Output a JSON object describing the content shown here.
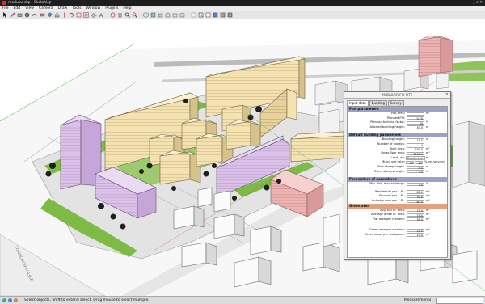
{
  "window": {
    "title": "modular.skp - SketchUp"
  },
  "menu": [
    "File",
    "Edit",
    "View",
    "Camera",
    "Draw",
    "Tools",
    "Window",
    "Plugins",
    "Help"
  ],
  "toolbar_icons": [
    "select-icon",
    "pencil-icon",
    "rectangle-icon",
    "circle-icon",
    "arc-icon",
    "eraser-icon",
    "paint-icon",
    "push-pull-icon",
    "move-icon",
    "rotate-icon",
    "scale-icon",
    "offset-icon",
    "tape-icon",
    "text-icon",
    "orbit-icon",
    "pan-icon",
    "zoom-icon",
    "zoom-extents-icon",
    "iso-view-icon",
    "top-view-icon",
    "front-view-icon",
    "right-view-icon",
    "back-view-icon",
    "left-view-icon",
    "xray-icon",
    "wireframe-icon",
    "hidden-line-icon",
    "shaded-icon",
    "textured-icon",
    "monochrome-icon"
  ],
  "street_label": "TONOLIKOVA ULICE",
  "panel": {
    "title": "MODULAR FIX SITE",
    "tabs": [
      "Input data",
      "Building",
      "Survey"
    ],
    "plot": {
      "header": "Plot parameters",
      "rows": [
        {
          "label": "Plot area:",
          "value": "",
          "unit": "m²"
        },
        {
          "label": "Planned FSI:",
          "value": "0.70",
          "unit": ""
        },
        {
          "label": "Planned building factor:",
          "value": "35",
          "unit": "%"
        },
        {
          "label": "Allowed building height:",
          "value": "40.0",
          "unit": "m"
        }
      ]
    },
    "default_building": {
      "header": "Default building parameters",
      "rows": [
        {
          "label": "Building height:",
          "value": "15.0",
          "unit": "m"
        },
        {
          "label": "Number of storeys:",
          "value": "4",
          "unit": ""
        },
        {
          "label": "Built area:",
          "value": "250.0",
          "unit": "m²"
        },
        {
          "label": "Gross floor area:",
          "value": "1000.0",
          "unit": "m²"
        },
        {
          "label": "Land use:",
          "value": "Residential",
          "unit": ""
        }
      ],
      "mixed_use": {
        "label": "Mixed use ratio:",
        "v1": "80",
        "v2": "20",
        "unit": "%",
        "note": "res.serv.ind"
      },
      "rows2": [
        {
          "label": "First storey height:",
          "value": "4.0",
          "unit": "m"
        },
        {
          "label": "Other storeys height:",
          "value": "3.5",
          "unit": "m"
        }
      ]
    },
    "norms": {
      "header": "Parameters of normatives",
      "rows": [
        {
          "label": "Min. dist. btw. buildings:",
          "value": "1.0",
          "unit": "%"
        },
        {
          "label": "Residential per 1 PL:",
          "value": "80.0",
          "unit": "m²"
        },
        {
          "label": "Services per 1 PL:",
          "value": "30.0",
          "unit": "m²"
        },
        {
          "label": "Industry area per 1 PL:",
          "value": "80.0",
          "unit": "m²"
        }
      ]
    },
    "green": {
      "header": "Green area",
      "rows": [
        {
          "label": "Avg. flat gr. area:",
          "value": "75.0",
          "unit": "m²"
        },
        {
          "label": "Average office gr. area:",
          "value": "75.0",
          "unit": "m²"
        },
        {
          "label": "Flat area per resident:",
          "value": "35.0",
          "unit": "m²"
        }
      ],
      "rows2": [
        {
          "label": "Green area per resident:",
          "value": "25.0",
          "unit": "m²"
        },
        {
          "label": "Green areas per workplace:",
          "value": "10.0",
          "unit": "m²"
        }
      ]
    }
  },
  "status": {
    "message": "Select objects. Shift to extend select. Drag mouse to select multiple.",
    "measurements_label": "Measurements"
  },
  "colors": {
    "slab": "#f4e3b0",
    "purple": "#d9bde8",
    "pink": "#eeb3b3",
    "grass": "#7dbb46",
    "panel_header": "#9aa3c7"
  }
}
